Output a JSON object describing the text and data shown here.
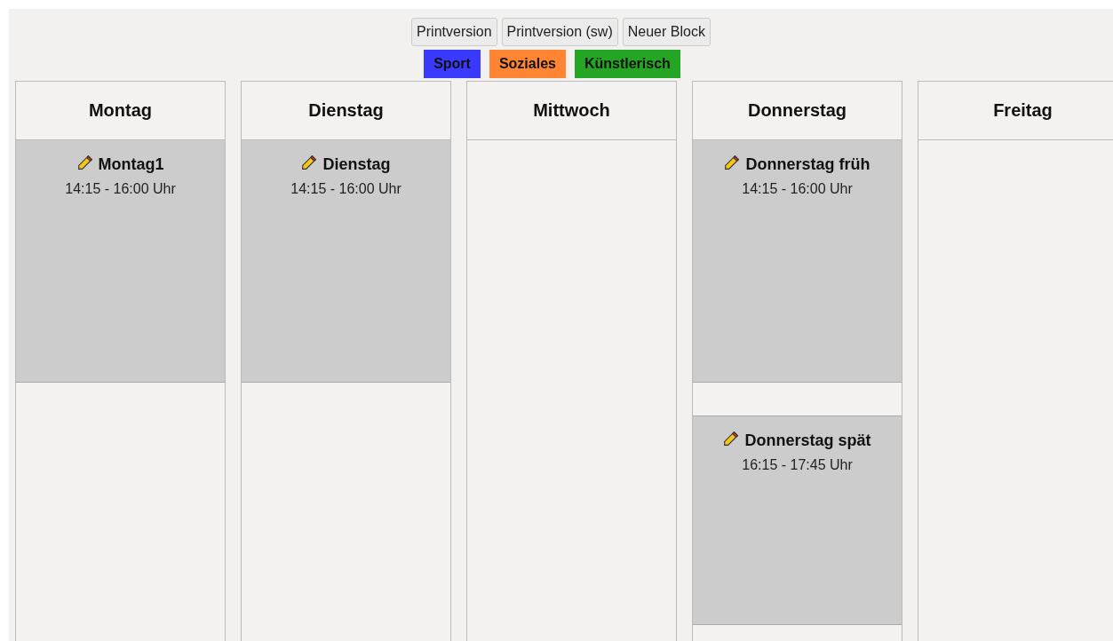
{
  "buttons": [
    "Printversion",
    "Printversion (sw)",
    "Neuer Block"
  ],
  "categories": [
    {
      "label": "Sport",
      "color": "#3a3aff"
    },
    {
      "label": "Soziales",
      "color": "#ff8533"
    },
    {
      "label": "Künstlerisch",
      "color": "#24a624"
    }
  ],
  "days": [
    {
      "name": "Montag",
      "blocks": [
        {
          "title": "Montag1",
          "time": "14:15 - 16:00 Uhr"
        }
      ]
    },
    {
      "name": "Dienstag",
      "blocks": [
        {
          "title": "Dienstag",
          "time": "14:15 - 16:00 Uhr"
        }
      ]
    },
    {
      "name": "Mittwoch"
    },
    {
      "name": "Donnerstag",
      "blocks": [
        {
          "title": "Donnerstag früh",
          "time": "14:15 - 16:00 Uhr"
        },
        {
          "title": "Donnerstag spät",
          "time": "16:15 - 17:45 Uhr"
        }
      ]
    },
    {
      "name": "Freitag"
    }
  ]
}
